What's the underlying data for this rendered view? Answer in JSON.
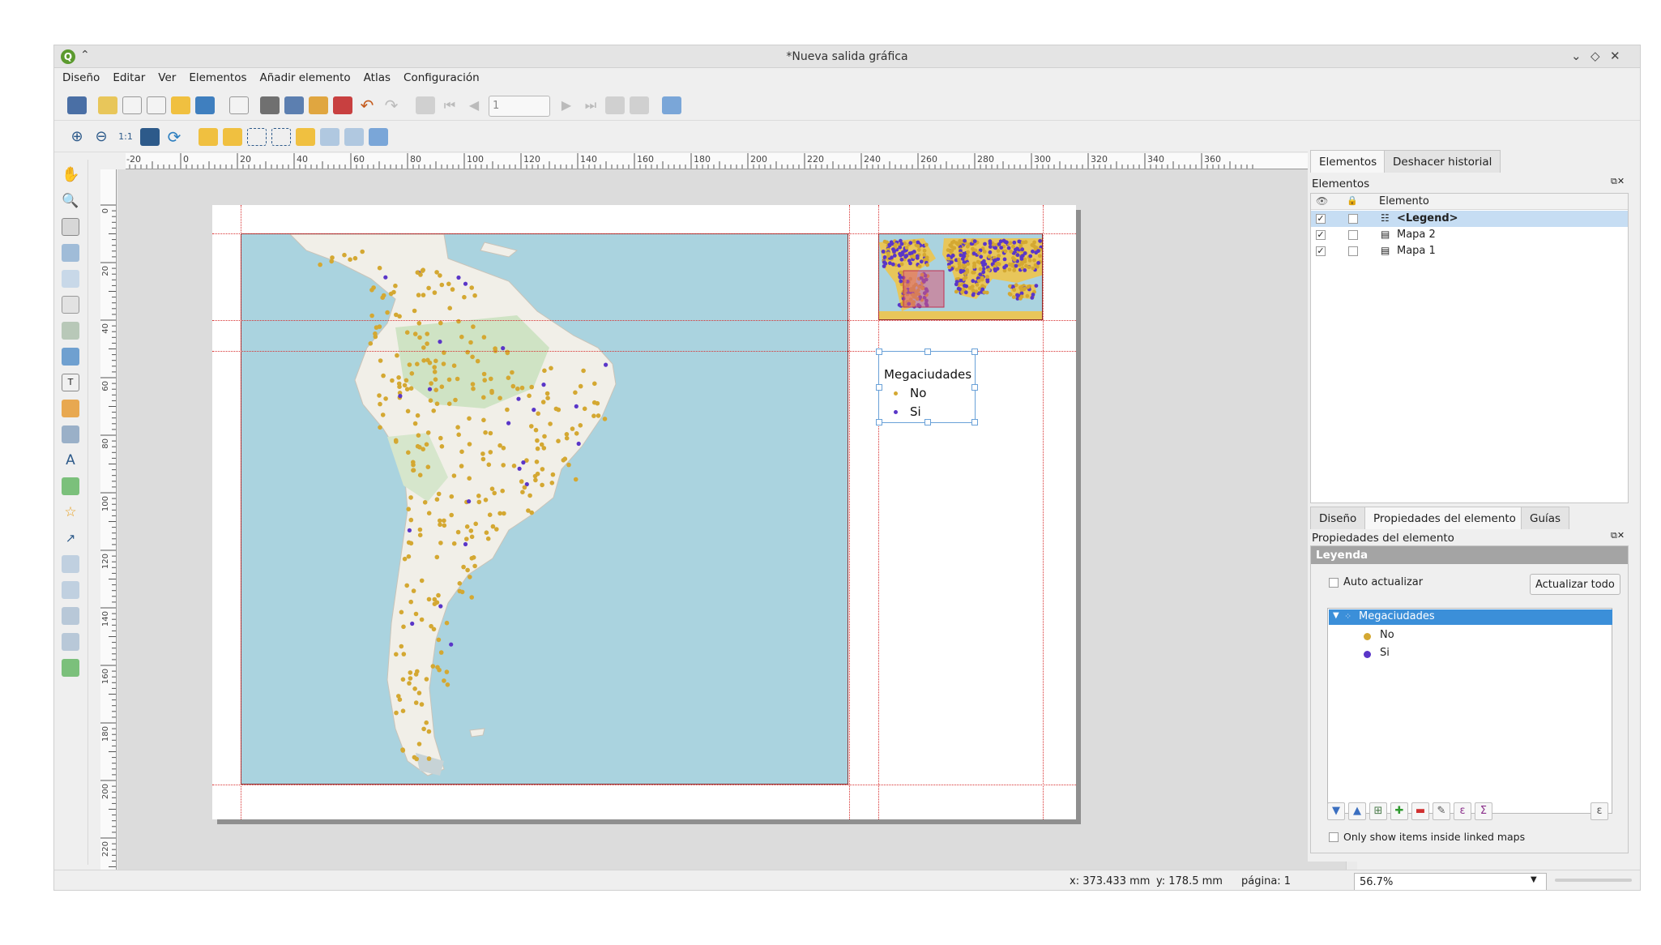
{
  "window": {
    "title": "*Nueva salida gráfica"
  },
  "menu": [
    "Diseño",
    "Editar",
    "Ver",
    "Elementos",
    "Añadir elemento",
    "Atlas",
    "Configuración"
  ],
  "toolbar": {
    "page_number": "1"
  },
  "ruler": {
    "h_ticks": [
      "-20",
      "0",
      "20",
      "40",
      "60",
      "80",
      "100",
      "120",
      "140",
      "160",
      "180",
      "200",
      "220",
      "240",
      "260",
      "280",
      "300",
      "320",
      "340",
      "360"
    ],
    "v_ticks": [
      "0",
      "20",
      "40",
      "60",
      "80",
      "100",
      "120",
      "140",
      "160",
      "180",
      "200",
      "220"
    ]
  },
  "legend_item": {
    "title": "Megaciudades",
    "entries": [
      "No",
      "Si"
    ]
  },
  "right_panel": {
    "tabs": [
      "Elementos",
      "Deshacer historial"
    ],
    "panel_title": "Elementos",
    "column_header": "Elemento",
    "items": [
      {
        "label": "<Legend>",
        "visible": true,
        "locked": false,
        "selected": true
      },
      {
        "label": "Mapa 2",
        "visible": true,
        "locked": false,
        "selected": false
      },
      {
        "label": "Mapa 1",
        "visible": true,
        "locked": false,
        "selected": false
      }
    ],
    "bottom_tabs": [
      "Diseño",
      "Propiedades del elemento",
      "Guías"
    ],
    "props_title": "Propiedades del elemento",
    "section_title": "Leyenda",
    "auto_update_label": "Auto actualizar",
    "update_all_label": "Actualizar todo",
    "tree": {
      "group": "Megaciudades",
      "entries": [
        "No",
        "Si"
      ]
    },
    "only_linked_label": "Only show items inside linked maps"
  },
  "status": {
    "x": "x: 373.433 mm",
    "y": "y: 178.5 mm",
    "page": "página: 1",
    "zoom": "56.7%"
  },
  "colors": {
    "no": "#d4a832",
    "si": "#5a36c8",
    "ocean": "#aad3df",
    "land": "#f1efe8",
    "guide": "#d83030",
    "selection": "#3b8fd9"
  }
}
